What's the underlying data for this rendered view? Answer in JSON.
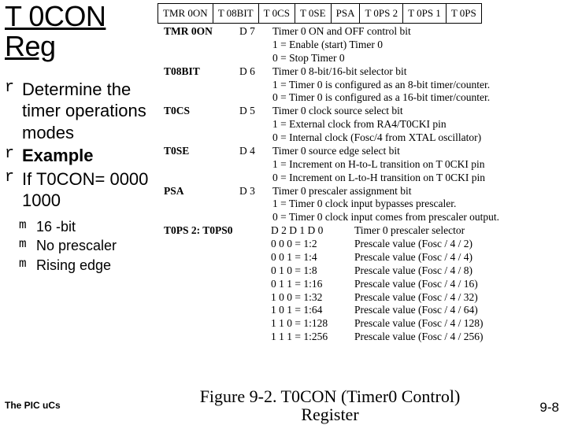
{
  "title_l1": "T 0CON",
  "title_l2": "Reg",
  "bullets": [
    {
      "mark": "r",
      "text": "Determine the timer operations modes"
    },
    {
      "mark": "r",
      "text": "Example",
      "bold": true
    },
    {
      "mark": "r",
      "text": "If T0CON= 0000 1000"
    }
  ],
  "subbullets": [
    {
      "mark": "m",
      "text": "16 -bit"
    },
    {
      "mark": "m",
      "text": "No prescaler"
    },
    {
      "mark": "m",
      "text": "Rising edge"
    }
  ],
  "footer_left": "The PIC uCs",
  "footer_right": "9-8",
  "header_cells": [
    "TMR 0ON",
    "T 08BIT",
    "T 0CS",
    "T 0SE",
    "PSA",
    "T 0PS 2",
    "T 0PS 1",
    "T 0PS"
  ],
  "defs": [
    {
      "name": "TMR 0ON",
      "bit": "D 7",
      "lines": [
        "Timer 0 ON and OFF control bit",
        "1 = Enable (start) Timer 0",
        "0 = Stop Timer 0"
      ]
    },
    {
      "name": "T08BIT",
      "bit": "D 6",
      "lines": [
        "Timer 0 8-bit/16-bit selector bit",
        "1 = Timer 0 is configured as an 8-bit timer/counter.",
        "0 = Timer 0 is configured as a 16-bit timer/counter."
      ]
    },
    {
      "name": "T0CS",
      "bit": "D 5",
      "lines": [
        "Timer 0 clock source select bit",
        "1 = External clock from RA4/T0CKI pin",
        "0 = Internal clock (Fosc/4 from XTAL oscillator)"
      ]
    },
    {
      "name": "T0SE",
      "bit": "D 4",
      "lines": [
        "Timer 0 source edge select bit",
        "1 = Increment on H-to-L transition on T 0CKI pin",
        "0 = Increment on L-to-H transition on T 0CKI pin"
      ]
    },
    {
      "name": "PSA",
      "bit": "D 3",
      "lines": [
        "Timer 0 prescaler assignment bit",
        "1 = Timer 0 clock input bypasses prescaler.",
        "0 = Timer 0 clock input comes from prescaler output."
      ]
    }
  ],
  "ps_label": "T0PS 2: T0PS0",
  "ps_bitcols": "D 2 D 1 D 0",
  "ps_title": "Timer 0 prescaler selector",
  "ps_rows": [
    {
      "code": "0 0 0 = 1:2",
      "desc": "Prescale value (Fosc / 4 / 2)"
    },
    {
      "code": "0 0 1 = 1:4",
      "desc": "Prescale value (Fosc / 4 / 4)"
    },
    {
      "code": "0 1 0 = 1:8",
      "desc": "Prescale value (Fosc / 4 / 8)"
    },
    {
      "code": "0 1 1 = 1:16",
      "desc": "Prescale value (Fosc / 4 / 16)"
    },
    {
      "code": "1 0 0 = 1:32",
      "desc": "Prescale value (Fosc / 4 / 32)"
    },
    {
      "code": "1 0 1 = 1:64",
      "desc": "Prescale value (Fosc / 4 / 64)"
    },
    {
      "code": "1 1 0 = 1:128",
      "desc": "Prescale value (Fosc / 4 / 128)"
    },
    {
      "code": "1 1 1 = 1:256",
      "desc": "Prescale value (Fosc / 4 / 256)"
    }
  ],
  "caption_l1": "Figure 9-2. T0CON (Timer0 Control)",
  "caption_l2": "Register"
}
